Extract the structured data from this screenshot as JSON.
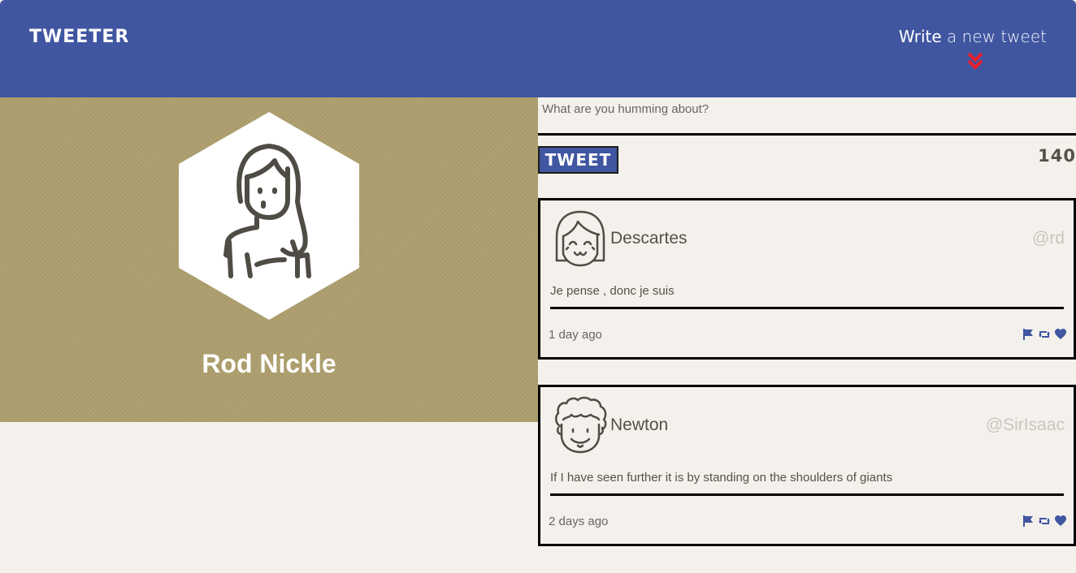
{
  "nav": {
    "brand": "TWEETER",
    "compose_bold": "Write",
    "compose_rest": " a new tweet",
    "compose_icon": "double-chevron-down-icon",
    "accent_color": "#4056a1",
    "chevron_color": "#e8202d"
  },
  "profile": {
    "name": "Rod Nickle",
    "avatar_icon": "woman-avatar-icon",
    "background_color": "#ad9f6d"
  },
  "composer": {
    "placeholder": "What are you humming about?",
    "submit_label": "TWEET",
    "counter": "140"
  },
  "tweets": [
    {
      "author": "Descartes",
      "handle": "@rd",
      "content": "Je pense , donc je suis",
      "time": "1 day ago",
      "avatar_icon": "girl-avatar-icon",
      "action_icons": [
        "flag-icon",
        "retweet-icon",
        "heart-icon"
      ]
    },
    {
      "author": "Newton",
      "handle": "@SirIsaac",
      "content": "If I have seen further it is by standing on the shoulders of giants",
      "time": "2 days ago",
      "avatar_icon": "curly-hair-avatar-icon",
      "action_icons": [
        "flag-icon",
        "retweet-icon",
        "heart-icon"
      ]
    }
  ]
}
